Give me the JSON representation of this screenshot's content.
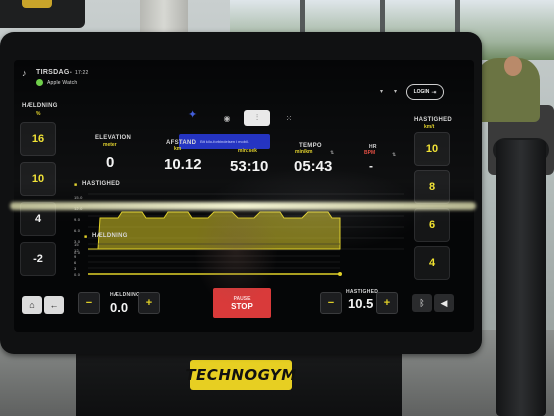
{
  "status_bar": {
    "day": "TIRSDAG",
    "time": "17:22",
    "device": "Apple Watch",
    "login": "LOGIN"
  },
  "left_panel": {
    "title": "HÆLDNING",
    "unit": "%",
    "presets": [
      "16",
      "10",
      "4",
      "-2"
    ]
  },
  "right_panel": {
    "title": "HASTIGHED",
    "unit": "km/t",
    "presets": [
      "10",
      "8",
      "6",
      "4"
    ]
  },
  "tabs": {
    "active_index": 2
  },
  "toast": {
    "text": "Bit kilo-forbindelsen i mobil."
  },
  "metrics": {
    "elevation": {
      "label": "ELEVATION",
      "unit": "meter",
      "value": "0"
    },
    "distance": {
      "label": "AFSTAND",
      "unit": "km",
      "value": "10.12"
    },
    "time": {
      "label": "",
      "unit": "min:sek",
      "value": "53:10"
    },
    "pace": {
      "label": "TEMPO",
      "unit": "min/km",
      "value": "05:43"
    },
    "hr": {
      "label": "HR",
      "unit": "BPM",
      "value": "-"
    }
  },
  "graph": {
    "speed_title": "HASTIGHED",
    "speed_ticks": [
      "15.0",
      "12.0",
      "9.0",
      "6.0",
      "3.0",
      "0.0"
    ],
    "incline_title": "HÆLDNING",
    "incline_ticks": [
      "15",
      "12",
      "9",
      "6",
      "3",
      "0.0"
    ]
  },
  "controls": {
    "incline_label": "HÆLDNING",
    "incline_value": "0.0",
    "pause_label": "PAUSE",
    "stop_label": "STOP",
    "speed_label": "HASTIGHED",
    "speed_value": "10.5"
  },
  "brand": "TECHNOGYM",
  "colors": {
    "accent": "#e0d028",
    "stop": "#d93a3a",
    "screen": "#050607"
  },
  "icons": [
    "home-icon",
    "back-icon",
    "bluetooth-icon",
    "speaker-icon",
    "walker-icon",
    "sort-icon"
  ]
}
